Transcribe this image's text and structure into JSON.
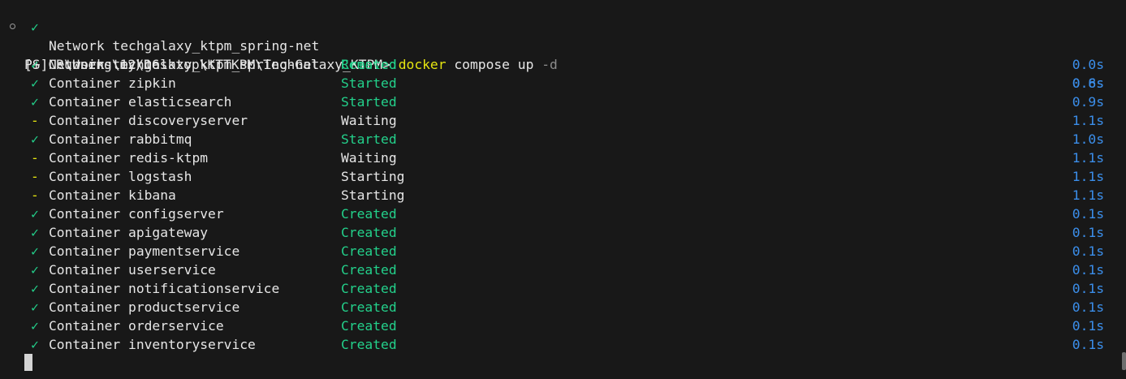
{
  "previous_line": {
    "glyph": "✓",
    "resource": "Network techgalaxy_ktpm_spring-net",
    "state": "Removed",
    "duration": "0.6s"
  },
  "prompt": {
    "path": "PS C:\\Users\\my\\Desktop\\KTTKPM\\TechGalaxy_KTPM>",
    "command": "docker",
    "args": "compose up",
    "flag": "-d"
  },
  "running": "[+] Running 12/16",
  "items": [
    {
      "glyph": "✓",
      "kind": "done",
      "resource": "Network techgalaxy_ktpm_spring-net",
      "state": "Created",
      "state_color": "green",
      "duration": "0.0s"
    },
    {
      "glyph": "✓",
      "kind": "done",
      "resource": "Container zipkin",
      "state": "Started",
      "state_color": "green",
      "duration": "0.8s"
    },
    {
      "glyph": "✓",
      "kind": "done",
      "resource": "Container elasticsearch",
      "state": "Started",
      "state_color": "green",
      "duration": "0.9s"
    },
    {
      "glyph": "-",
      "kind": "pending",
      "resource": "Container discoveryserver",
      "state": "Waiting",
      "state_color": "plain",
      "duration": "1.1s"
    },
    {
      "glyph": "✓",
      "kind": "done",
      "resource": "Container rabbitmq",
      "state": "Started",
      "state_color": "green",
      "duration": "1.0s"
    },
    {
      "glyph": "-",
      "kind": "pending",
      "resource": "Container redis-ktpm",
      "state": "Waiting",
      "state_color": "plain",
      "duration": "1.1s"
    },
    {
      "glyph": "-",
      "kind": "pending",
      "resource": "Container logstash",
      "state": "Starting",
      "state_color": "plain",
      "duration": "1.1s"
    },
    {
      "glyph": "-",
      "kind": "pending",
      "resource": "Container kibana",
      "state": "Starting",
      "state_color": "plain",
      "duration": "1.1s"
    },
    {
      "glyph": "✓",
      "kind": "done",
      "resource": "Container configserver",
      "state": "Created",
      "state_color": "green",
      "duration": "0.1s"
    },
    {
      "glyph": "✓",
      "kind": "done",
      "resource": "Container apigateway",
      "state": "Created",
      "state_color": "green",
      "duration": "0.1s"
    },
    {
      "glyph": "✓",
      "kind": "done",
      "resource": "Container paymentservice",
      "state": "Created",
      "state_color": "green",
      "duration": "0.1s"
    },
    {
      "glyph": "✓",
      "kind": "done",
      "resource": "Container userservice",
      "state": "Created",
      "state_color": "green",
      "duration": "0.1s"
    },
    {
      "glyph": "✓",
      "kind": "done",
      "resource": "Container notificationservice",
      "state": "Created",
      "state_color": "green",
      "duration": "0.1s"
    },
    {
      "glyph": "✓",
      "kind": "done",
      "resource": "Container productservice",
      "state": "Created",
      "state_color": "green",
      "duration": "0.1s"
    },
    {
      "glyph": "✓",
      "kind": "done",
      "resource": "Container orderservice",
      "state": "Created",
      "state_color": "green",
      "duration": "0.1s"
    },
    {
      "glyph": "✓",
      "kind": "done",
      "resource": "Container inventoryservice",
      "state": "Created",
      "state_color": "green",
      "duration": "0.1s"
    }
  ],
  "colors": {
    "background": "#181818",
    "green": "#23d18b",
    "yellow": "#e5e510",
    "blue": "#3b8eea",
    "text": "#e6e6e6"
  }
}
